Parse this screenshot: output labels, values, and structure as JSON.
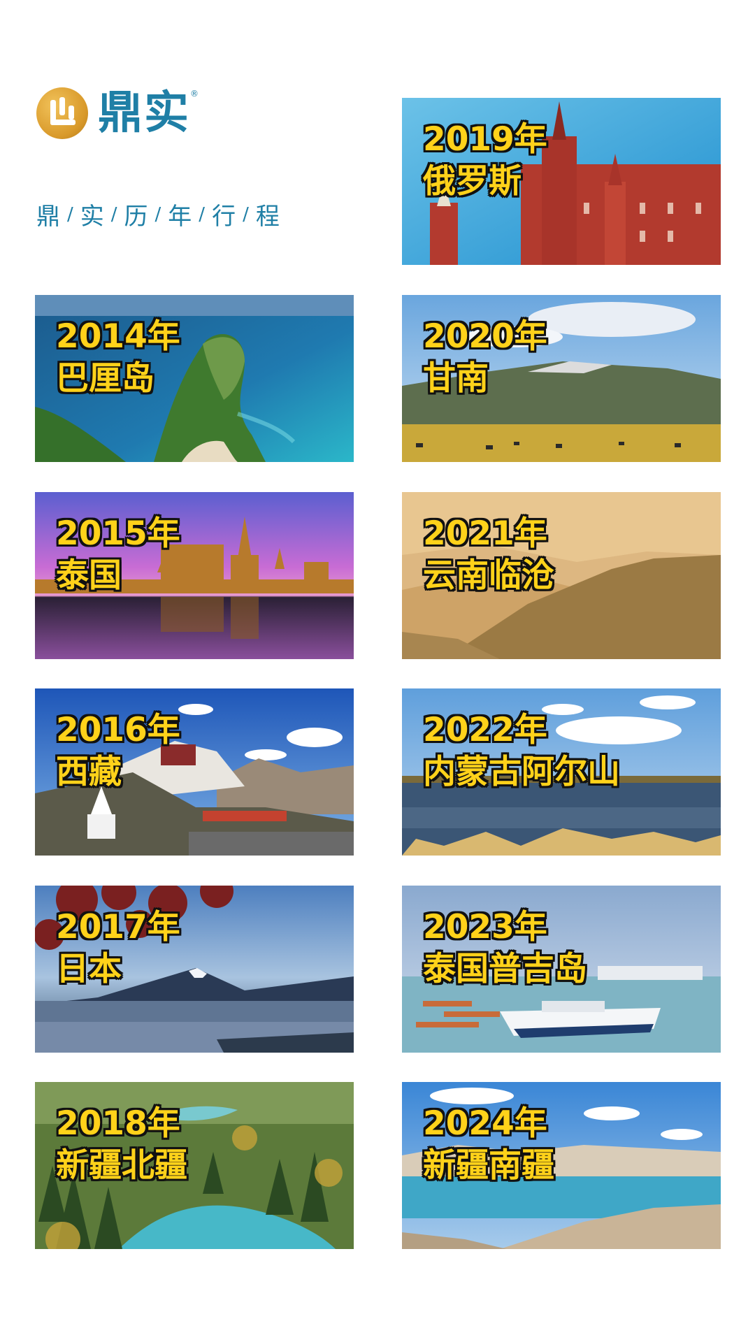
{
  "header": {
    "logo_text": "鼎实",
    "logo_reg": "®",
    "subtitle_chars": [
      "鼎",
      "实",
      "历",
      "年",
      "行",
      "程"
    ],
    "subtitle_separator": "/"
  },
  "trips": [
    {
      "year": "2014年",
      "place": "巴厘岛",
      "scene": "coastal-cliff"
    },
    {
      "year": "2015年",
      "place": "泰国",
      "scene": "temple-sunset"
    },
    {
      "year": "2016年",
      "place": "西藏",
      "scene": "potala-palace"
    },
    {
      "year": "2017年",
      "place": "日本",
      "scene": "mount-fuji"
    },
    {
      "year": "2018年",
      "place": "新疆北疆",
      "scene": "forest-river"
    },
    {
      "year": "2019年",
      "place": "俄罗斯",
      "scene": "red-square"
    },
    {
      "year": "2020年",
      "place": "甘南",
      "scene": "grassland-mountains"
    },
    {
      "year": "2021年",
      "place": "云南临沧",
      "scene": "misty-hills"
    },
    {
      "year": "2022年",
      "place": "内蒙古阿尔山",
      "scene": "lake-grass"
    },
    {
      "year": "2023年",
      "place": "泰国普吉岛",
      "scene": "harbor-boats"
    },
    {
      "year": "2024年",
      "place": "新疆南疆",
      "scene": "mountain-lake"
    }
  ],
  "colors": {
    "brand_blue": "#1f7fa6",
    "brand_gold": "#d99a2b",
    "label_yellow": "#ffd21a",
    "label_outline": "#111111"
  }
}
